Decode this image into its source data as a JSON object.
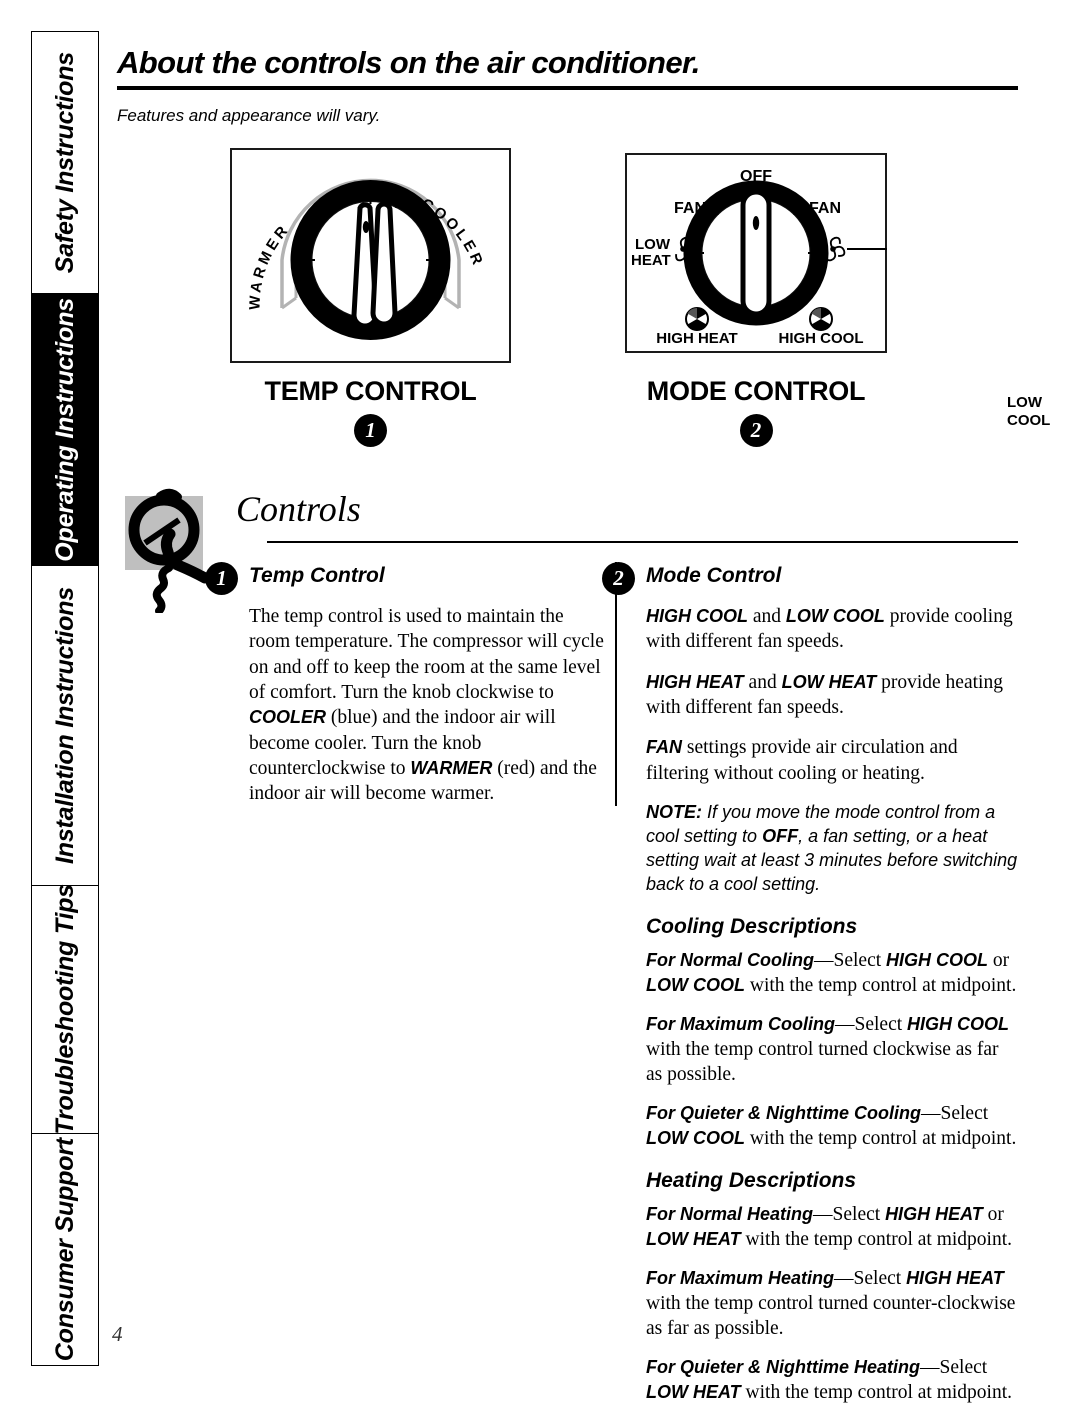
{
  "sidebar": {
    "items": [
      {
        "label": "Safety Instructions",
        "dark": false
      },
      {
        "label": "Operating Instructions",
        "dark": true
      },
      {
        "label": "Installation Instructions",
        "dark": false
      },
      {
        "label": "Troubleshooting Tips",
        "dark": false
      },
      {
        "label": "Consumer Support",
        "dark": false
      }
    ]
  },
  "page_number": "4",
  "header": {
    "title": "About the controls on the air conditioner.",
    "subtitle": "Features and appearance will vary."
  },
  "diagrams": {
    "temp": {
      "caption": "TEMP CONTROL",
      "badge": "1",
      "labels": {
        "left": "WARMER",
        "right": "COOLER"
      }
    },
    "mode": {
      "caption": "MODE CONTROL",
      "badge": "2",
      "labels": {
        "off": "OFF",
        "fan_left": "FAN",
        "fan_right": "FAN",
        "low_heat": "LOW\nHEAT",
        "low_heat_line1": "LOW",
        "low_heat_line2": "HEAT",
        "low_cool_line1": "LOW",
        "low_cool_line2": "COOL",
        "high_heat": "HIGH HEAT",
        "high_cool": "HIGH COOL"
      }
    }
  },
  "controls_section": {
    "title": "Controls",
    "knob_icon": "knob-hand-icon"
  },
  "left_column": {
    "badge": "1",
    "title": "Temp Control",
    "paragraph_parts": {
      "p1": "The temp control is used to maintain the room temperature. The compressor will cycle on and off to keep the room at the same level of comfort. Turn the knob clockwise to ",
      "kw1": "COOLER",
      "p2": " (blue) and the indoor air will become cooler. Turn the knob counterclockwise to ",
      "kw2": "WARMER",
      "p3": " (red) and the indoor air will become warmer."
    }
  },
  "right_column": {
    "badge": "2",
    "title": "Mode Control",
    "para_cool": {
      "kw1": "HIGH COOL",
      "mid": " and ",
      "kw2": "LOW COOL",
      "tail": "  provide cooling with different fan speeds."
    },
    "para_heat": {
      "kw1": "HIGH HEAT",
      "mid": " and ",
      "kw2": "LOW HEAT",
      "tail": " provide heating with different fan speeds."
    },
    "para_fan": {
      "kw1": "FAN",
      "tail": " settings provide air circulation and filtering without cooling or heating."
    },
    "note": {
      "label": "NOTE:",
      "t1": " If you move the mode control from a cool setting to ",
      "kw": "OFF",
      "t2": ", a fan setting, or a heat setting wait at least 3 minutes before switching back to a cool setting."
    },
    "cooling_heading": "Cooling Descriptions",
    "cooling_items": [
      {
        "lead": "For Normal Cooling",
        "dash": "—",
        "mid": "Select ",
        "kw1": "HIGH COOL",
        "conj": " or ",
        "kw2": "LOW COOL",
        "tail": " with the temp control at midpoint."
      },
      {
        "lead": "For Maximum Cooling",
        "dash": "—",
        "mid": "Select ",
        "kw1": "HIGH COOL",
        "conj": "",
        "kw2": "",
        "tail": " with the temp control turned clockwise as far as possible."
      },
      {
        "lead": "For Quieter & Nighttime Cooling",
        "dash": "—",
        "mid": "Select ",
        "kw1": "",
        "conj": "",
        "kw2": "LOW COOL",
        "tail": " with the temp control at midpoint."
      }
    ],
    "heating_heading": "Heating Descriptions",
    "heating_items": [
      {
        "lead": "For Normal Heating",
        "dash": "—",
        "mid": "Select ",
        "kw1": "HIGH HEAT",
        "conj": " or ",
        "kw2": "LOW HEAT",
        "tail": " with the temp control at midpoint."
      },
      {
        "lead": "For Maximum Heating",
        "dash": "—",
        "mid": "Select ",
        "kw1": "HIGH HEAT",
        "conj": "",
        "kw2": "",
        "tail": " with the temp control turned counter-clockwise as far as possible."
      },
      {
        "lead": "For Quieter & Nighttime Heating",
        "dash": "—",
        "mid": "Select ",
        "kw1": "",
        "conj": "",
        "kw2": "LOW HEAT",
        "tail": " with the temp control at midpoint."
      }
    ]
  },
  "colors": {
    "ink": "#000000",
    "knob_bg": "#bfbfbf",
    "arc_gray": "#b3b3b3"
  }
}
